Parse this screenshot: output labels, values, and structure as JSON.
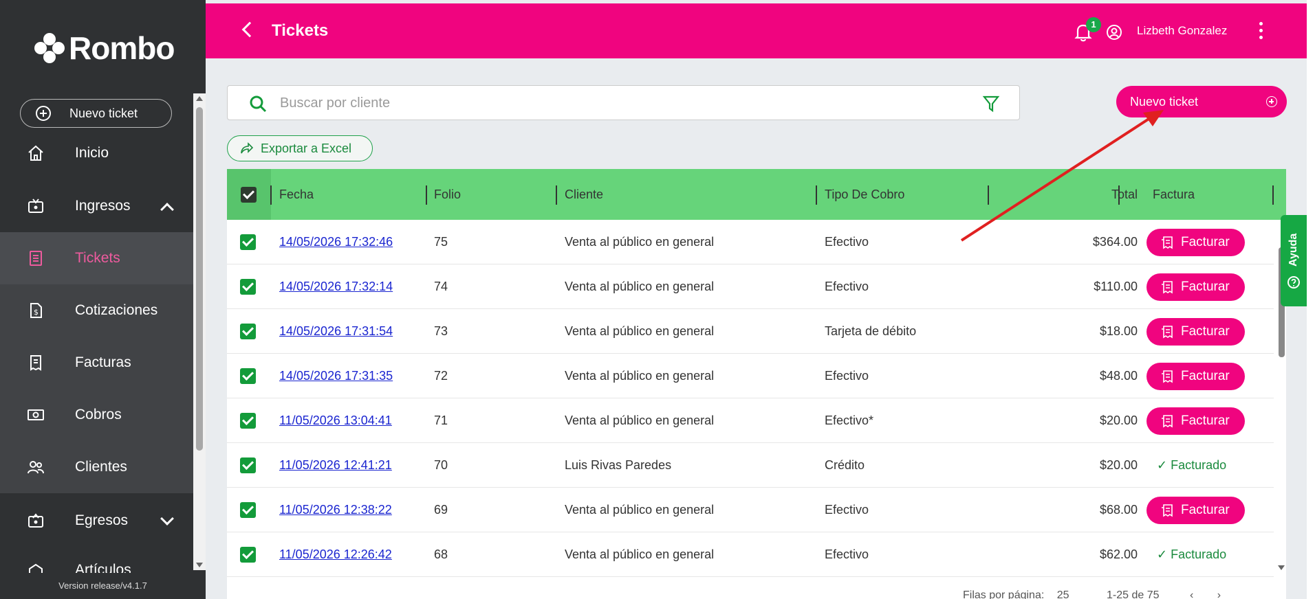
{
  "brand": {
    "name": "Rombo"
  },
  "sidebar": {
    "new_ticket_label": "Nuevo ticket",
    "items": [
      {
        "label": "Inicio",
        "icon": "home-icon"
      },
      {
        "label": "Ingresos",
        "icon": "income-icon",
        "expanded": true
      },
      {
        "label": "Tickets",
        "icon": "ticket-icon",
        "active": true
      },
      {
        "label": "Cotizaciones",
        "icon": "quote-icon"
      },
      {
        "label": "Facturas",
        "icon": "invoice-icon"
      },
      {
        "label": "Cobros",
        "icon": "money-icon"
      },
      {
        "label": "Clientes",
        "icon": "clients-icon"
      },
      {
        "label": "Egresos",
        "icon": "expense-icon",
        "expanded": false
      },
      {
        "label": "Artículos",
        "icon": "articles-icon"
      }
    ],
    "version": "Version release/v4.1.7"
  },
  "header": {
    "title": "Tickets",
    "notifications_count": "1",
    "user_name": "Lizbeth Gonzalez"
  },
  "toolbar": {
    "search_placeholder": "Buscar por cliente",
    "new_ticket_label": "Nuevo ticket",
    "export_label": "Exportar a Excel"
  },
  "table": {
    "columns": [
      "Fecha",
      "Folio",
      "Cliente",
      "Tipo De Cobro",
      "Total",
      "Factura"
    ],
    "rows": [
      {
        "fecha": "14/05/2026  17:32:46",
        "folio": "75",
        "cliente": "Venta al público en general",
        "tipo": "Efectivo",
        "total": "$364.00",
        "factura": "Facturar"
      },
      {
        "fecha": "14/05/2026  17:32:14",
        "folio": "74",
        "cliente": "Venta al público en general",
        "tipo": "Efectivo",
        "total": "$110.00",
        "factura": "Facturar"
      },
      {
        "fecha": "14/05/2026  17:31:54",
        "folio": "73",
        "cliente": "Venta al público en general",
        "tipo": "Tarjeta de débito",
        "total": "$18.00",
        "factura": "Facturar"
      },
      {
        "fecha": "14/05/2026  17:31:35",
        "folio": "72",
        "cliente": "Venta al público en general",
        "tipo": "Efectivo",
        "total": "$48.00",
        "factura": "Facturar"
      },
      {
        "fecha": "11/05/2026  13:04:41",
        "folio": "71",
        "cliente": "Venta al público en general",
        "tipo": "Efectivo*",
        "total": "$20.00",
        "factura": "Facturar"
      },
      {
        "fecha": "11/05/2026  12:41:21",
        "folio": "70",
        "cliente": "Luis Rivas Paredes",
        "tipo": "Crédito",
        "total": "$20.00",
        "factura": "✓ Facturado"
      },
      {
        "fecha": "11/05/2026  12:38:22",
        "folio": "69",
        "cliente": "Venta al público en general",
        "tipo": "Efectivo",
        "total": "$68.00",
        "factura": "Facturar"
      },
      {
        "fecha": "11/05/2026  12:26:42",
        "folio": "68",
        "cliente": "Venta al público en general",
        "tipo": "Efectivo",
        "total": "$62.00",
        "factura": "✓ Facturado"
      }
    ]
  },
  "pagination": {
    "rows_per_page_label": "Filas por página:",
    "rows_per_page": "25",
    "range": "1-25 de 75"
  },
  "help_tab": {
    "label": "Ayuda"
  },
  "colors": {
    "brand_pink": "#f0047f",
    "header_green": "#66d47a",
    "check_green": "#139b3a",
    "sidebar_dark": "#2f3133",
    "active_text": "#ee5b9e",
    "annotation_red": "#e02020"
  }
}
